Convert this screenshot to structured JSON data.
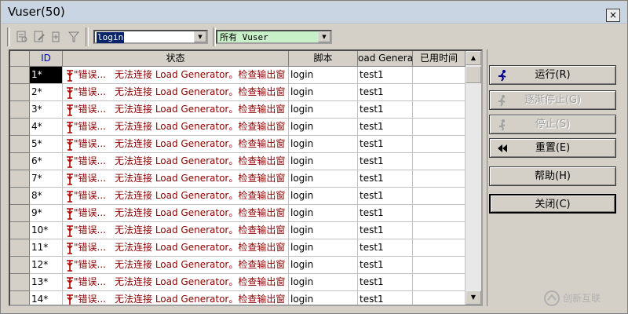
{
  "window": {
    "title": "Vuser(50)",
    "close_label": "×"
  },
  "toolbar": {
    "combo1": {
      "value": "login"
    },
    "combo2": {
      "value": "所有 Vuser"
    },
    "icons": [
      "details-icon",
      "edit-icon",
      "add-icon",
      "filter-icon"
    ]
  },
  "grid": {
    "headers": {
      "id": "ID",
      "status": "状态",
      "script": "脚本",
      "load_gen": "oad Generat",
      "elapsed": "已用时间"
    },
    "rows": [
      {
        "id": "1*",
        "status_prefix": "\"错误...",
        "status_msg": "无法连接 Load Generator。检查输出窗",
        "script": "login",
        "load_gen": "test1",
        "elapsed": ""
      },
      {
        "id": "2*",
        "status_prefix": "\"错误...",
        "status_msg": "无法连接 Load Generator。检查输出窗",
        "script": "login",
        "load_gen": "test1",
        "elapsed": ""
      },
      {
        "id": "3*",
        "status_prefix": "\"错误...",
        "status_msg": "无法连接 Load Generator。检查输出窗",
        "script": "login",
        "load_gen": "test1",
        "elapsed": ""
      },
      {
        "id": "4*",
        "status_prefix": "\"错误...",
        "status_msg": "无法连接 Load Generator。检查输出窗",
        "script": "login",
        "load_gen": "test1",
        "elapsed": ""
      },
      {
        "id": "5*",
        "status_prefix": "\"错误...",
        "status_msg": "无法连接 Load Generator。检查输出窗",
        "script": "login",
        "load_gen": "test1",
        "elapsed": ""
      },
      {
        "id": "6*",
        "status_prefix": "\"错误...",
        "status_msg": "无法连接 Load Generator。检查输出窗",
        "script": "login",
        "load_gen": "test1",
        "elapsed": ""
      },
      {
        "id": "7*",
        "status_prefix": "\"错误...",
        "status_msg": "无法连接 Load Generator。检查输出窗",
        "script": "login",
        "load_gen": "test1",
        "elapsed": ""
      },
      {
        "id": "8*",
        "status_prefix": "\"错误...",
        "status_msg": "无法连接 Load Generator。检查输出窗",
        "script": "login",
        "load_gen": "test1",
        "elapsed": ""
      },
      {
        "id": "9*",
        "status_prefix": "\"错误...",
        "status_msg": "无法连接 Load Generator。检查输出窗",
        "script": "login",
        "load_gen": "test1",
        "elapsed": ""
      },
      {
        "id": "10*",
        "status_prefix": "\"错误...",
        "status_msg": "无法连接 Load Generator。检查输出窗",
        "script": "login",
        "load_gen": "test1",
        "elapsed": ""
      },
      {
        "id": "11*",
        "status_prefix": "\"错误...",
        "status_msg": "无法连接 Load Generator。检查输出窗",
        "script": "login",
        "load_gen": "test1",
        "elapsed": ""
      },
      {
        "id": "12*",
        "status_prefix": "\"错误...",
        "status_msg": "无法连接 Load Generator。检查输出窗",
        "script": "login",
        "load_gen": "test1",
        "elapsed": ""
      },
      {
        "id": "13*",
        "status_prefix": "\"错误...",
        "status_msg": "无法连接 Load Generator。检查输出窗",
        "script": "login",
        "load_gen": "test1",
        "elapsed": ""
      },
      {
        "id": "14*",
        "status_prefix": "\"错误...",
        "status_msg": "无法连接 Load Generator。检查输出窗",
        "script": "login",
        "load_gen": "test1",
        "elapsed": ""
      }
    ]
  },
  "buttons": {
    "run": "运行(R)",
    "gradual_stop": "逐渐停止(G)",
    "stop": "停止(S)",
    "reset": "重置(E)",
    "help": "帮助(H)",
    "close": "关闭(C)"
  },
  "colors": {
    "header_accent": "#0000cc",
    "status_text": "#8b0000",
    "combo_bg": "#c8f0c8",
    "selection": "#000000"
  }
}
